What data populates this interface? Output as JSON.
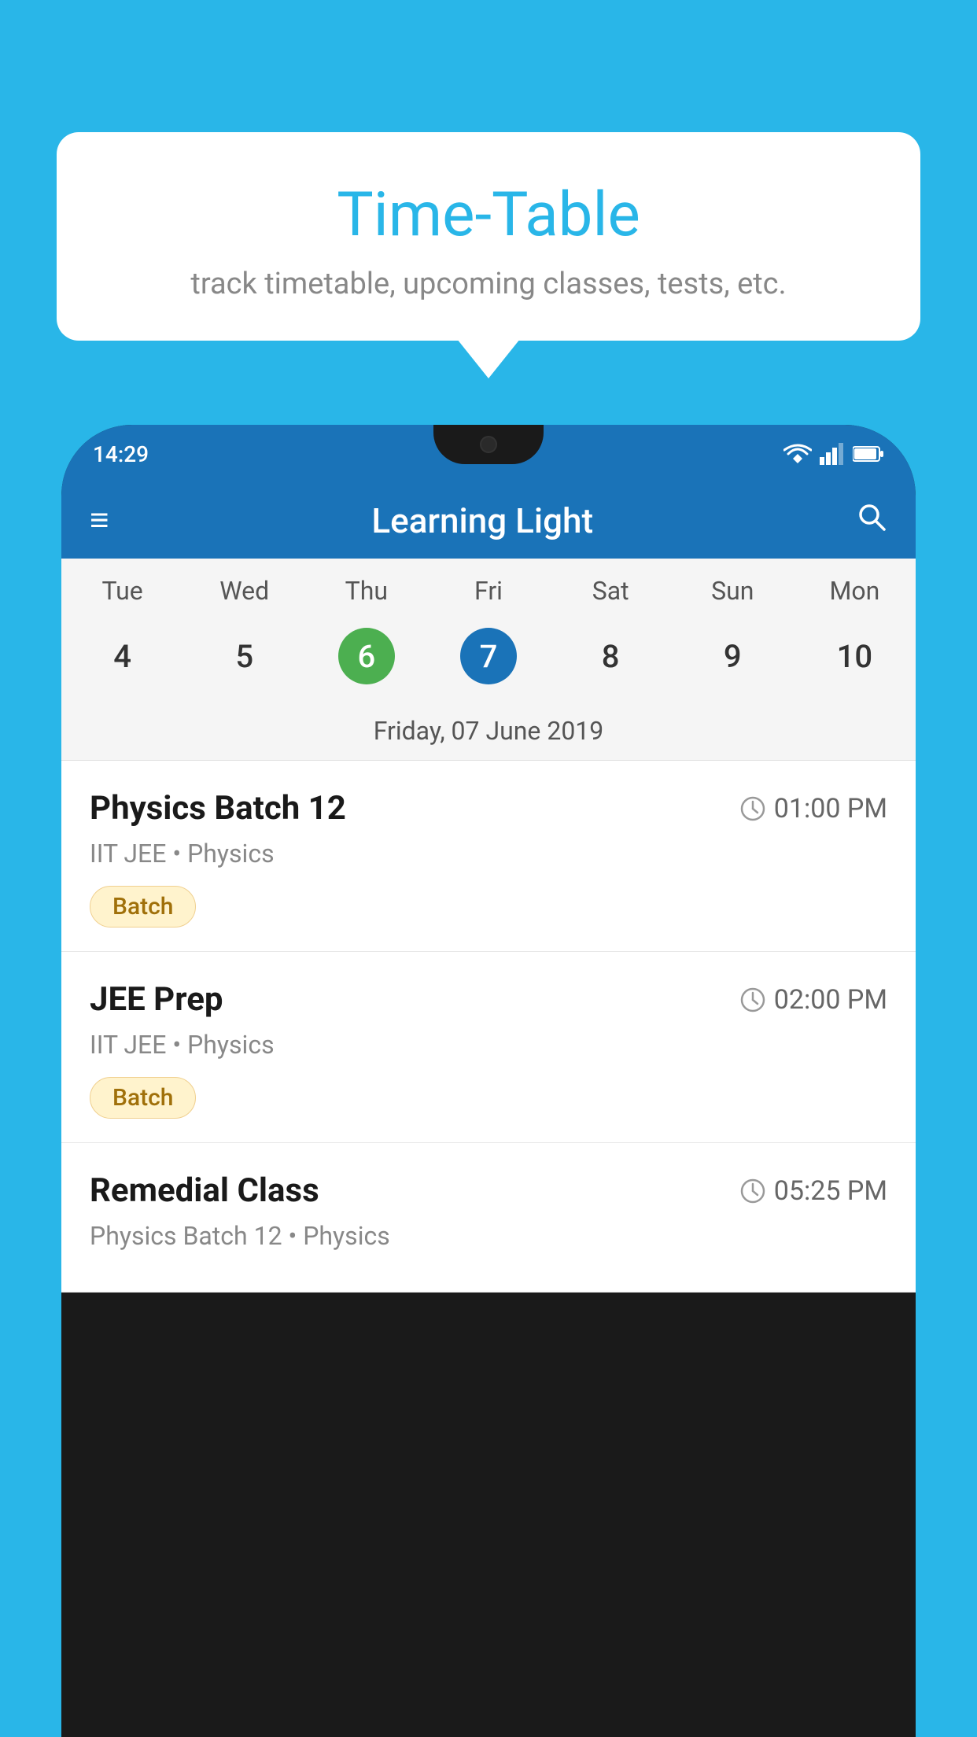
{
  "background_color": "#29b6e8",
  "tooltip": {
    "title": "Time-Table",
    "subtitle": "track timetable, upcoming classes, tests, etc."
  },
  "phone": {
    "status_bar": {
      "time": "14:29"
    },
    "app_bar": {
      "title": "Learning Light",
      "menu_icon": "≡",
      "search_icon": "🔍"
    },
    "calendar": {
      "day_labels": [
        "Tue",
        "Wed",
        "Thu",
        "Fri",
        "Sat",
        "Sun",
        "Mon"
      ],
      "dates": [
        {
          "value": "4",
          "state": "normal"
        },
        {
          "value": "5",
          "state": "normal"
        },
        {
          "value": "6",
          "state": "today"
        },
        {
          "value": "7",
          "state": "selected"
        },
        {
          "value": "8",
          "state": "normal"
        },
        {
          "value": "9",
          "state": "normal"
        },
        {
          "value": "10",
          "state": "normal"
        }
      ],
      "selected_date_label": "Friday, 07 June 2019"
    },
    "schedule": [
      {
        "title": "Physics Batch 12",
        "time": "01:00 PM",
        "sub": "IIT JEE • Physics",
        "badge": "Batch"
      },
      {
        "title": "JEE Prep",
        "time": "02:00 PM",
        "sub": "IIT JEE • Physics",
        "badge": "Batch"
      },
      {
        "title": "Remedial Class",
        "time": "05:25 PM",
        "sub": "Physics Batch 12 • Physics",
        "badge": ""
      }
    ]
  }
}
